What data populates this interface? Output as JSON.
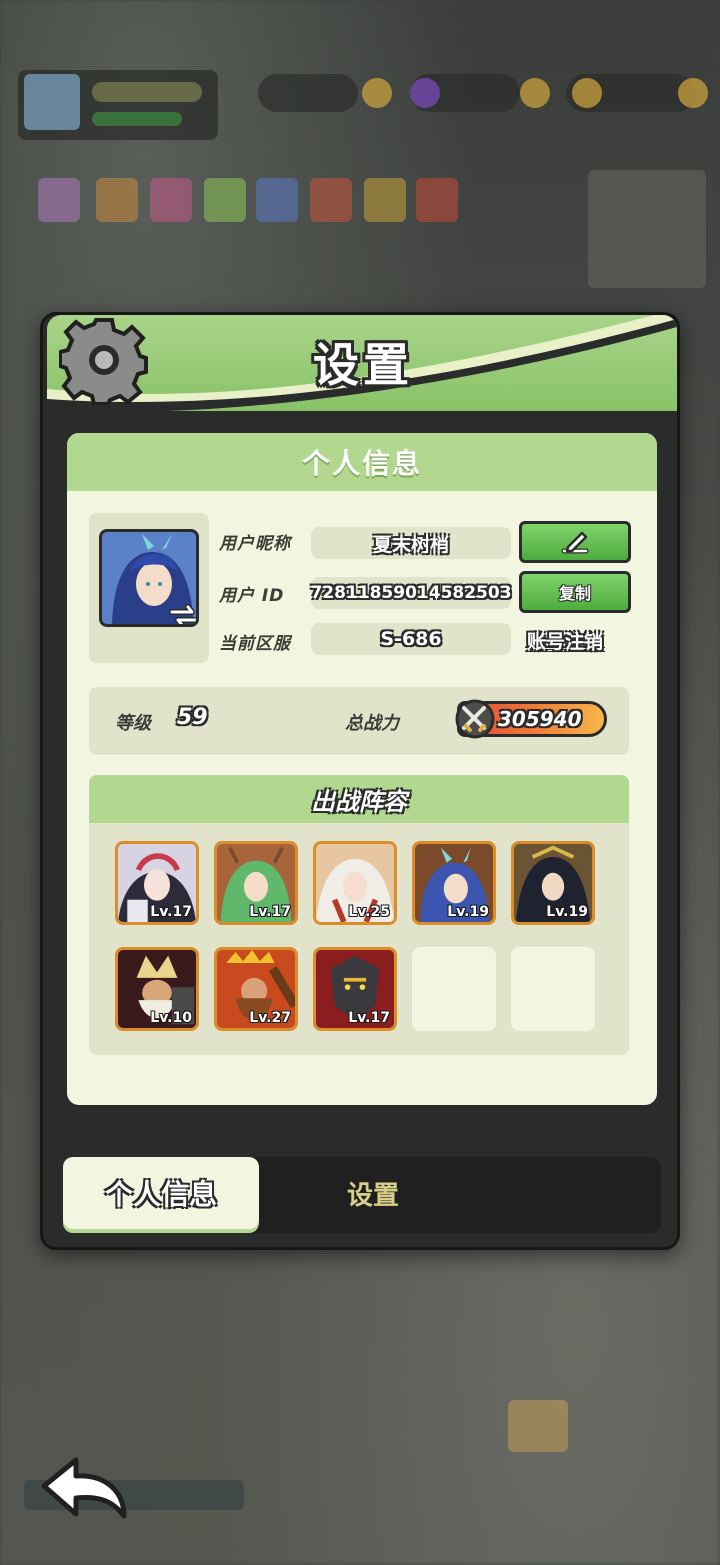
{
  "dialog": {
    "title": "设置"
  },
  "personal_info": {
    "section_title": "个人信息",
    "nickname_label": "用户昵称",
    "nickname_value": "夏末树梢",
    "edit_button_icon": "pencil-icon",
    "id_label": "用户 ID",
    "id_value": "72811859014582503",
    "copy_button": "复制",
    "server_label": "当前区服",
    "server_value": "S-686",
    "cancel_account": "账号注销",
    "level_label": "等级",
    "level_value": "59",
    "power_label": "总战力",
    "power_value": "305940"
  },
  "lineup": {
    "title": "出战阵容",
    "heroes": [
      {
        "level": "Lv.17",
        "color": "#c9c2d6"
      },
      {
        "level": "Lv.17",
        "color": "#6fbf7a"
      },
      {
        "level": "Lv.25",
        "color": "#e6b8a8"
      },
      {
        "level": "Lv.19",
        "color": "#4e70c0"
      },
      {
        "level": "Lv.19",
        "color": "#6b5a3e"
      },
      {
        "level": "Lv.10",
        "color": "#b4432e"
      },
      {
        "level": "Lv.27",
        "color": "#c96a2a"
      },
      {
        "level": "Lv.17",
        "color": "#4a4544"
      }
    ],
    "empty_slots": 2
  },
  "tabs": {
    "personal_info": "个人信息",
    "settings": "设置"
  },
  "colors": {
    "header_green": "#a9d489",
    "panel_bg": "#f2f5df",
    "button_green": "#4fab3e",
    "hero_frame": "#d98e2a"
  }
}
